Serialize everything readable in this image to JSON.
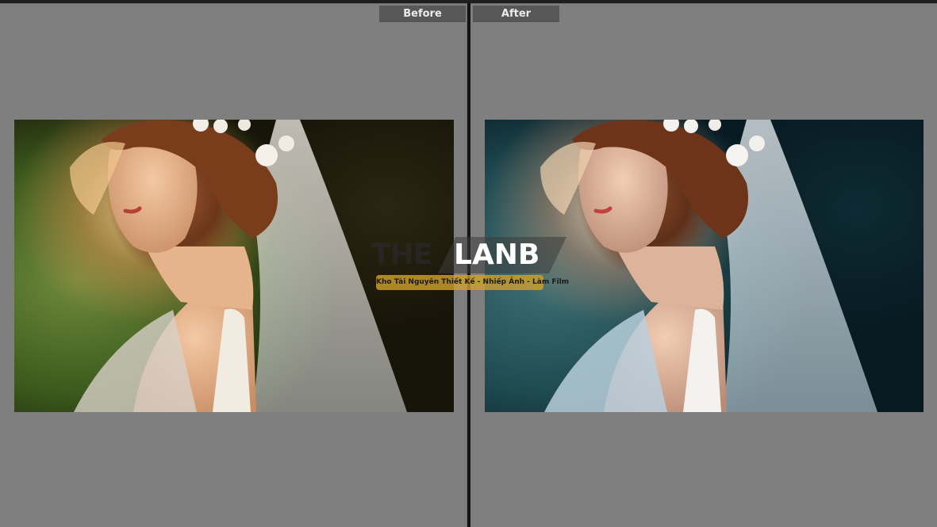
{
  "compare_view": {
    "before_label": "Before",
    "after_label": "After"
  },
  "watermark": {
    "brand_dark": "THE",
    "brand_light": "LANB",
    "tagline": "Kho Tài Nguyên Thiết Kế - Nhiếp Ảnh - Làm Film"
  },
  "colors": {
    "background": "#7f7f7f",
    "label_bg": "#585858",
    "divider": "#141414",
    "tag_bg": "#cda028"
  }
}
